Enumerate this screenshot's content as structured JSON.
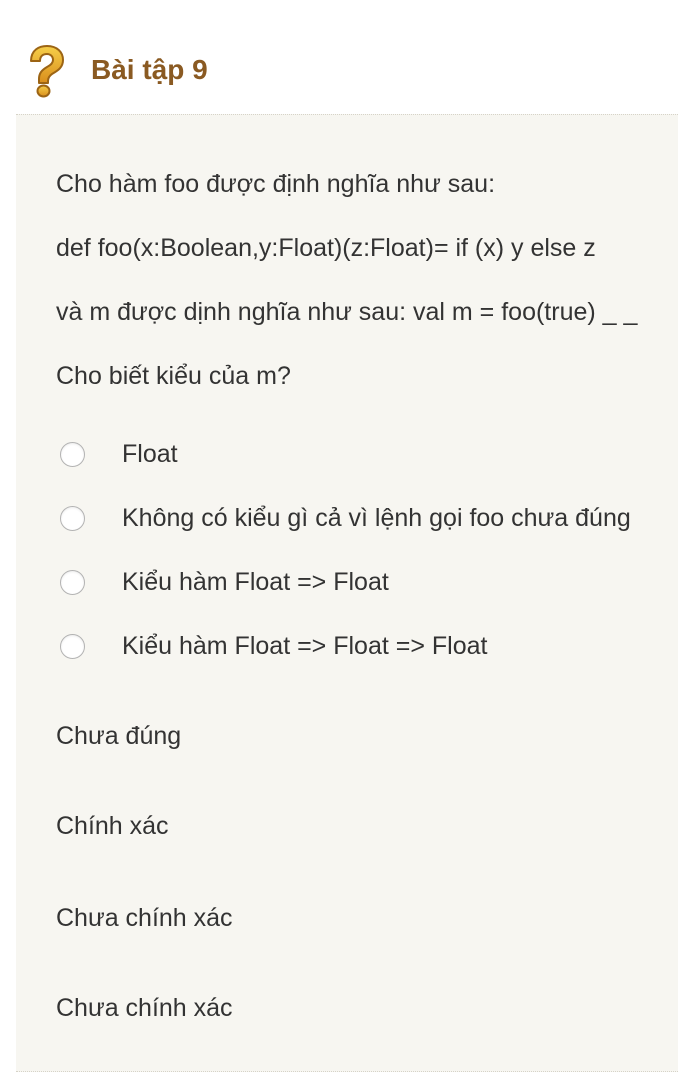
{
  "exercise": {
    "title": "Bài tập 9",
    "icon": "question-mark-icon",
    "icon_color": "#e0a72a",
    "title_color": "#8a5a22",
    "panel_color": "#f7f6f1"
  },
  "question": {
    "lines": [
      "Cho hàm foo được định nghĩa như sau:",
      "def foo(x:Boolean,y:Float)(z:Float)= if (x) y else z",
      "và m được dịnh nghĩa như sau: val m = foo(true) _ _",
      "Cho biết kiểu của m?"
    ]
  },
  "options": [
    {
      "label": "Float",
      "selected": false
    },
    {
      "label": "Không có kiểu gì cả vì lệnh gọi foo chưa đúng",
      "selected": false
    },
    {
      "label": "Kiểu hàm Float => Float",
      "selected": false
    },
    {
      "label": "Kiểu hàm Float => Float => Float",
      "selected": false
    }
  ],
  "feedback": [
    "Chưa đúng",
    "Chính xác",
    "Chưa chính xác",
    "Chưa chính xác"
  ]
}
